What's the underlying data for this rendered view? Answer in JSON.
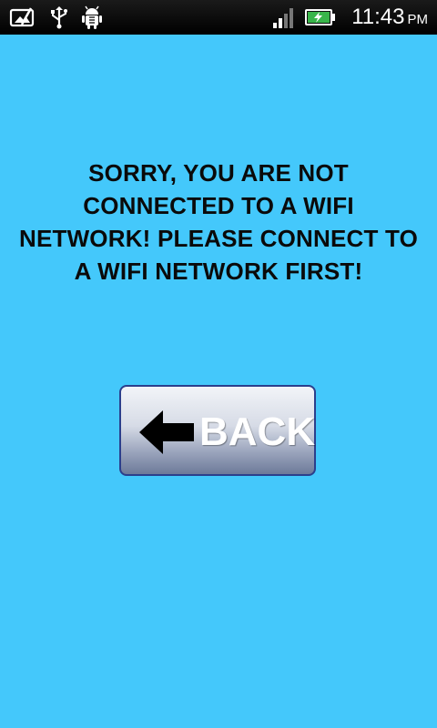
{
  "status_bar": {
    "time": "11:43",
    "ampm": "PM",
    "icons": [
      "gallery-icon",
      "usb-icon",
      "android-debug-icon",
      "signal-icon",
      "battery-charging-icon"
    ],
    "battery_color": "#39b54a"
  },
  "message": {
    "text": "SORRY, YOU ARE NOT CONNECTED TO A WIFI NETWORK! PLEASE CONNECT TO A WIFI NETWORK FIRST!"
  },
  "back_button": {
    "label": "BACK",
    "icon": "left-arrow-icon"
  },
  "colors": {
    "background": "#44c8fb",
    "button_border": "#2b3f8c"
  }
}
